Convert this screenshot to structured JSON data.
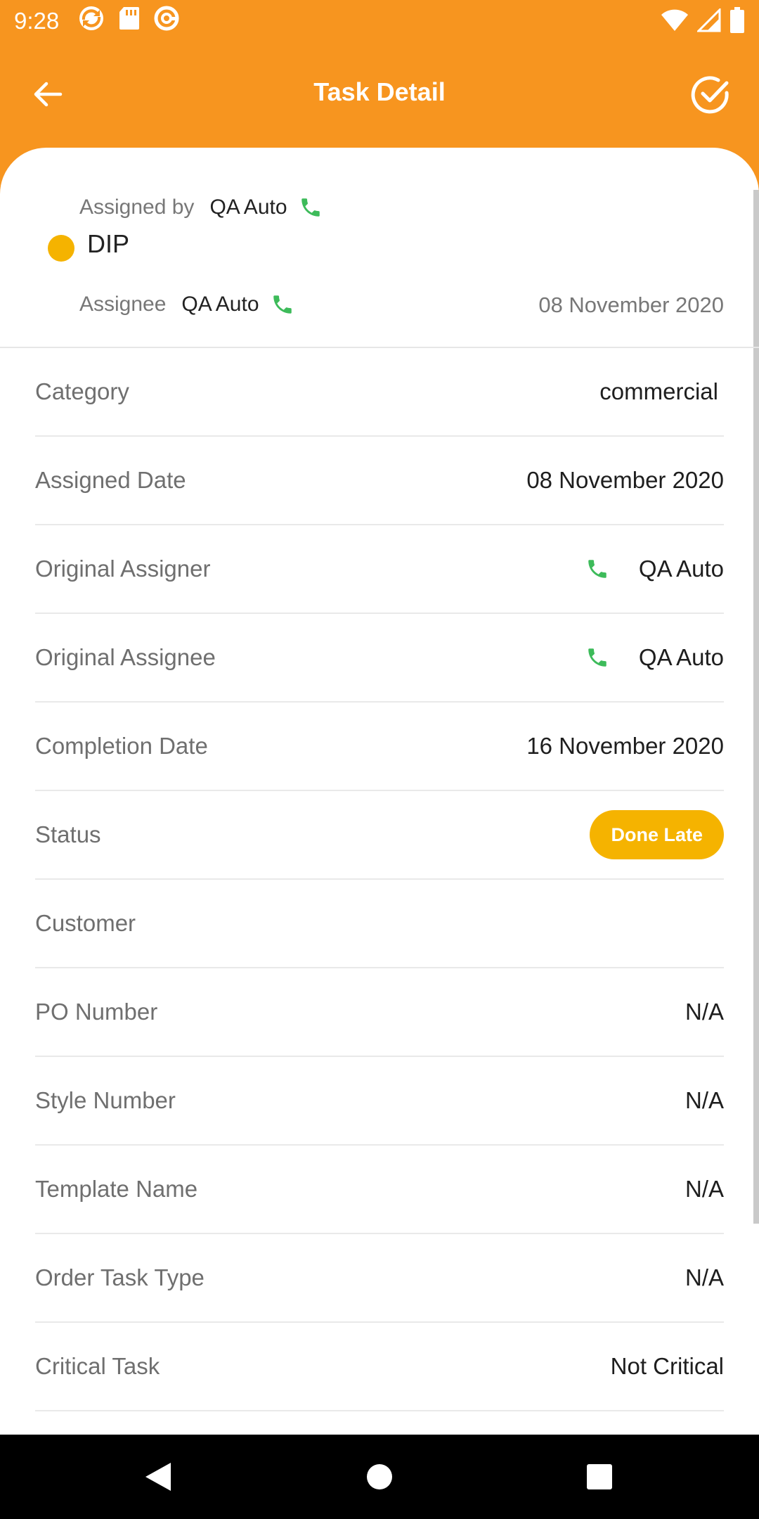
{
  "status_bar": {
    "time": "9:28",
    "icons": [
      "sync-icon",
      "sd-card-icon",
      "at-sign-icon",
      "wifi-icon",
      "signal-icon",
      "battery-icon"
    ]
  },
  "app_bar": {
    "title": "Task Detail",
    "back_icon": "arrow-left-icon",
    "confirm_icon": "check-circle-icon"
  },
  "header": {
    "assigned_by_label": "Assigned by",
    "assigned_by_value": "QA Auto",
    "task_name": "DIP",
    "assignee_label": "Assignee",
    "assignee_value": "QA Auto",
    "date": "08 November 2020",
    "status_dot_color": "#f5b300"
  },
  "details": [
    {
      "label": "Category",
      "value": "commercial"
    },
    {
      "label": "Assigned Date",
      "value": "08 November 2020"
    },
    {
      "label": "Original Assigner",
      "value": "QA Auto",
      "phone": true
    },
    {
      "label": "Original Assignee",
      "value": "QA Auto",
      "phone": true
    },
    {
      "label": "Completion Date",
      "value": "16 November 2020"
    },
    {
      "label": "Status",
      "value": "Done Late",
      "badge": true
    },
    {
      "label": "Customer",
      "value": ""
    },
    {
      "label": "PO Number",
      "value": "N/A"
    },
    {
      "label": "Style Number",
      "value": "N/A"
    },
    {
      "label": "Template Name",
      "value": "N/A"
    },
    {
      "label": "Order Task Type",
      "value": "N/A"
    },
    {
      "label": "Critical Task",
      "value": "Not Critical"
    }
  ],
  "colors": {
    "primary": "#f7951f",
    "status_badge": "#f5b300",
    "phone_icon": "#3dbb5a"
  }
}
